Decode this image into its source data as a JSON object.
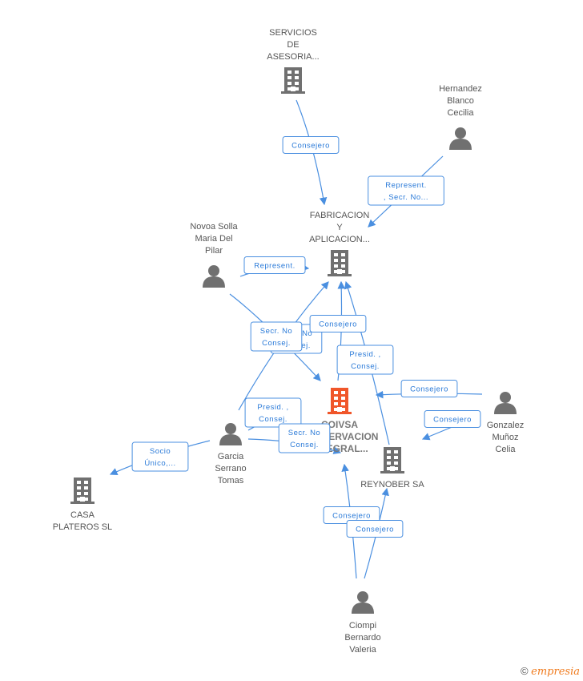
{
  "colors": {
    "main_company": "#f0562a",
    "node": "#707070",
    "edge": "#4a8fe0"
  },
  "nodes": {
    "servicios": {
      "type": "company",
      "lines": [
        "SERVICIOS",
        "DE",
        "ASESORIA..."
      ]
    },
    "hernandez": {
      "type": "person",
      "lines": [
        "Hernandez",
        "Blanco",
        "Cecilia"
      ]
    },
    "fabricacion": {
      "type": "company",
      "lines": [
        "FABRICACION",
        "Y",
        "APLICACION..."
      ]
    },
    "novoa": {
      "type": "person",
      "lines": [
        "Novoa Solla",
        "Maria Del",
        "Pilar"
      ]
    },
    "coivsa": {
      "type": "company-main",
      "lines": [
        "COIVSA",
        "CONSERVACION",
        "INTEGRAL..."
      ]
    },
    "gonzalez": {
      "type": "person",
      "lines": [
        "Gonzalez",
        "Muñoz",
        "Celia"
      ]
    },
    "garcia": {
      "type": "person",
      "lines": [
        "Garcia",
        "Serrano",
        "Tomas"
      ]
    },
    "reynober": {
      "type": "company",
      "lines": [
        "REYNOBER SA"
      ]
    },
    "casa": {
      "type": "company",
      "lines": [
        "CASA",
        "PLATEROS SL"
      ]
    },
    "ciompi": {
      "type": "person",
      "lines": [
        "Ciompi",
        "Bernardo",
        "Valeria"
      ]
    }
  },
  "edges": [
    {
      "from": "servicios",
      "to": "fabricacion",
      "lines": [
        "Consejero"
      ]
    },
    {
      "from": "hernandez",
      "to": "fabricacion",
      "lines": [
        "Represent.",
        ", Secr. No..."
      ]
    },
    {
      "from": "novoa",
      "to": "fabricacion",
      "lines": [
        "Represent."
      ]
    },
    {
      "from": "garcia",
      "to": "fabricacion",
      "lines": [
        "Secr. No",
        "Consej."
      ]
    },
    {
      "from": "novoa",
      "to": "coivsa",
      "lines": [
        "Secr. No",
        "Consej."
      ]
    },
    {
      "from": "coivsa",
      "to": "fabricacion",
      "lines": [
        "Consejero"
      ]
    },
    {
      "from": "reynober",
      "to": "fabricacion",
      "lines": [
        "Presid. ,",
        "Consej."
      ]
    },
    {
      "from": "gonzalez",
      "to": "coivsa",
      "lines": [
        "Consejero"
      ]
    },
    {
      "from": "gonzalez",
      "to": "reynober",
      "lines": [
        "Consejero"
      ]
    },
    {
      "from": "garcia",
      "to": "coivsa",
      "lines": [
        "Presid. ,",
        "Consej."
      ]
    },
    {
      "from": "garcia",
      "to": "coivsa",
      "lines": [
        "Secr. No",
        "Consej."
      ]
    },
    {
      "from": "garcia",
      "to": "casa",
      "lines": [
        "Socio",
        "Único,..."
      ]
    },
    {
      "from": "ciompi",
      "to": "reynober",
      "lines": [
        "Consejero"
      ]
    },
    {
      "from": "ciompi",
      "to": "reynober",
      "lines": [
        "Consejero"
      ]
    }
  ],
  "footer": {
    "copyright": "©",
    "brand_initial": "e",
    "brand_rest": "mpresia"
  }
}
